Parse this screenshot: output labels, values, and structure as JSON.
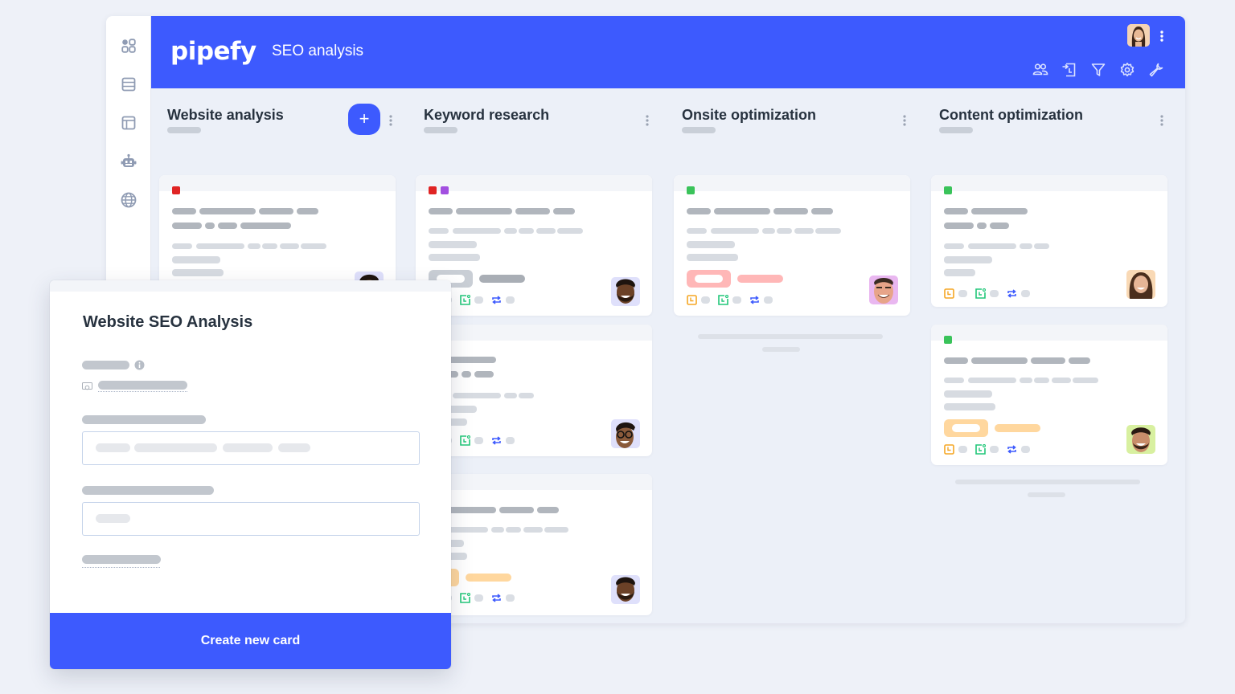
{
  "app": {
    "logo": "pipefy",
    "pipe_title": "SEO analysis",
    "brand_color": "#3d5afe"
  },
  "sidebar": {
    "items": [
      {
        "icon": "grid-icon"
      },
      {
        "icon": "list-icon"
      },
      {
        "icon": "layout-icon"
      },
      {
        "icon": "robot-icon"
      },
      {
        "icon": "globe-icon"
      }
    ]
  },
  "header": {
    "tools": [
      "members-icon",
      "import-icon",
      "filter-icon",
      "settings-icon",
      "wrench-icon"
    ]
  },
  "columns": [
    {
      "title": "Website analysis",
      "has_add": true,
      "add_label": "+"
    },
    {
      "title": "Keyword research",
      "has_add": false
    },
    {
      "title": "Onsite optimization",
      "has_add": false
    },
    {
      "title": "Content optimization",
      "has_add": false
    }
  ],
  "tag_colors": {
    "red": "#e02424",
    "purple": "#a24fe0",
    "green": "#3ac35a",
    "orange": "#f5a623",
    "teal": "#22c77a",
    "blue": "#3d5afe",
    "pink_pill": "#ffb7b7",
    "gray_pill": "#c9ced5",
    "peach_pill": "#ffd79e"
  },
  "modal": {
    "title": "Website SEO Analysis",
    "create_button": "Create new card"
  }
}
